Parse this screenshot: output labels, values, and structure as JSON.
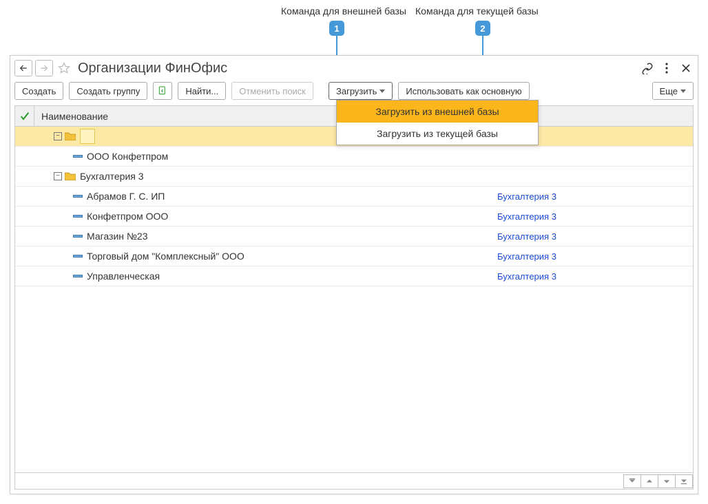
{
  "annotations": {
    "a1": {
      "label": "Команда для внешней базы",
      "number": "1"
    },
    "a2": {
      "label": "Команда для текущей базы",
      "number": "2"
    }
  },
  "page_title": "Организации ФинОфис",
  "toolbar": {
    "create": "Создать",
    "create_group": "Создать группу",
    "find": "Найти...",
    "cancel_search": "Отменить поиск",
    "load": "Загрузить",
    "use_as_main": "Использовать как основную",
    "more": "Еще"
  },
  "dropdown": {
    "item_external": "Загрузить из внешней базы",
    "item_current": "Загрузить из текущей базы"
  },
  "table": {
    "header_name": "Наименование",
    "rows": [
      {
        "type": "folder",
        "indent": 1,
        "name": "",
        "toggle": "−",
        "base": "",
        "selected": true
      },
      {
        "type": "item",
        "indent": 2,
        "name": "ООО Конфетпром",
        "base": ""
      },
      {
        "type": "folder",
        "indent": 1,
        "name": "Бухгалтерия 3",
        "toggle": "−",
        "base": ""
      },
      {
        "type": "item",
        "indent": 2,
        "name": "Абрамов Г. С. ИП",
        "base": "Бухгалтерия 3"
      },
      {
        "type": "item",
        "indent": 2,
        "name": "Конфетпром ООО",
        "base": "Бухгалтерия 3"
      },
      {
        "type": "item",
        "indent": 2,
        "name": "Магазин №23",
        "base": "Бухгалтерия 3"
      },
      {
        "type": "item",
        "indent": 2,
        "name": "Торговый дом \"Комплексный\" ООО",
        "base": "Бухгалтерия 3"
      },
      {
        "type": "item",
        "indent": 2,
        "name": "Управленческая",
        "base": "Бухгалтерия 3"
      }
    ]
  }
}
